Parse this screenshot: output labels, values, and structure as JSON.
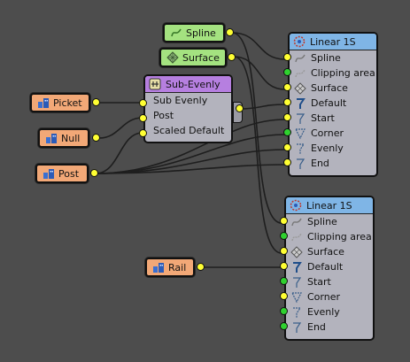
{
  "inputs": {
    "spline": {
      "label": "Spline",
      "icon": "spline-icon"
    },
    "surface": {
      "label": "Surface",
      "icon": "surface-icon"
    },
    "picket": {
      "label": "Picket",
      "icon": "building-icon"
    },
    "null": {
      "label": "Null",
      "icon": "building-icon"
    },
    "post": {
      "label": "Post",
      "icon": "building-icon"
    },
    "rail": {
      "label": "Rail",
      "icon": "building-icon"
    }
  },
  "sub_evenly": {
    "title": "Sub-Evenly",
    "rows": [
      "Sub Evenly",
      "Post",
      "Scaled Default"
    ]
  },
  "linear_a": {
    "title": "Linear 1S",
    "rows": [
      "Spline",
      "Clipping area",
      "Surface",
      "Default",
      "Start",
      "Corner",
      "Evenly",
      "End"
    ]
  },
  "linear_b": {
    "title": "Linear 1S",
    "rows": [
      "Spline",
      "Clipping area",
      "Surface",
      "Default",
      "Start",
      "Corner",
      "Evenly",
      "End"
    ]
  },
  "colors": {
    "background": "#4d4d4d",
    "object_node": "#f2a877",
    "generator_node": "#a4e280",
    "linear_header": "#7fb5e6",
    "sub_header": "#b67fe0",
    "port_yellow": "#ffff33",
    "port_green": "#2fd12f"
  }
}
